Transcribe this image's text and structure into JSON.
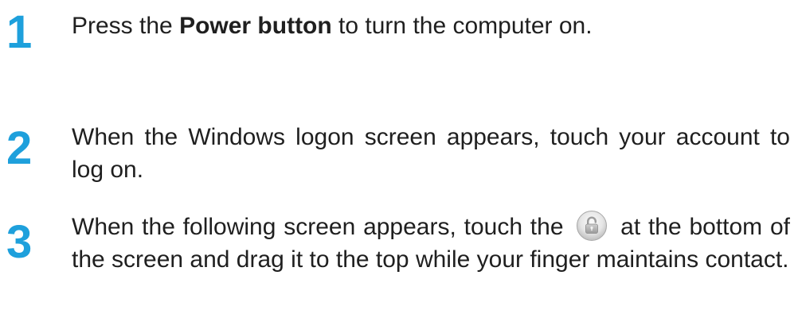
{
  "steps": [
    {
      "number": "1",
      "text_before": "Press the ",
      "bold": "Power button",
      "text_after": " to turn the computer on."
    },
    {
      "number": "2",
      "text": "When the Windows logon screen appears, touch your account to log on."
    },
    {
      "number": "3",
      "text_before": "When the following screen appears, touch the ",
      "icon": "lock-icon",
      "text_after": " at the bottom of the screen and drag it to the top while your finger maintains contact."
    }
  ],
  "colors": {
    "step_number": "#1ea0dc",
    "text": "#1f1f1f"
  }
}
